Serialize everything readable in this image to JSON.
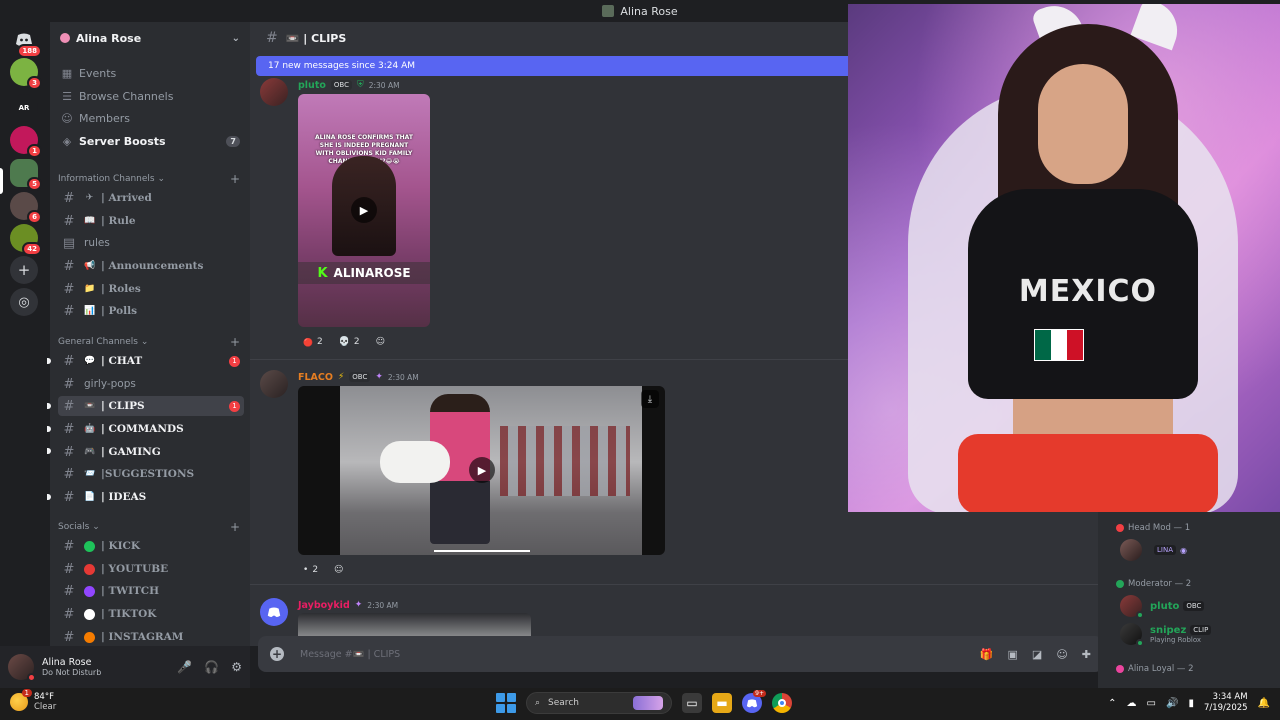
{
  "window": {
    "title": "Alina Rose"
  },
  "rail": {
    "servers": [
      {
        "name": "discord-home",
        "badge": "188",
        "color": "#5865f2"
      },
      {
        "name": "server-2",
        "badge": "3",
        "color": "#7cb342"
      },
      {
        "name": "server-ar",
        "label": "AR",
        "badge": "",
        "color": "#1e1f22"
      },
      {
        "name": "server-4",
        "badge": "1",
        "color": "#c2185b"
      },
      {
        "name": "server-5",
        "badge": "5",
        "color": "#4e7a4e"
      },
      {
        "name": "server-6",
        "badge": "6",
        "color": "#5a4a48"
      },
      {
        "name": "server-7",
        "badge": "42",
        "color": "#6b8e23"
      }
    ],
    "add_label": "+",
    "explore_label": "◎"
  },
  "server": {
    "name": "Alina Rose"
  },
  "nav": {
    "events": "Events",
    "browse": "Browse Channels",
    "members": "Members",
    "boosts": "Server Boosts",
    "boosts_count": "7"
  },
  "categories": {
    "info": "Information Channels",
    "general": "General Channels",
    "socials": "Socials"
  },
  "channels": {
    "arrived": {
      "emoji": "✈",
      "name": "| Arrived"
    },
    "rule": {
      "emoji": "📖",
      "name": "| Rule"
    },
    "rules": {
      "name": "rules"
    },
    "announcements": {
      "emoji": "📢",
      "name": "| Announcements"
    },
    "roles": {
      "emoji": "📁",
      "name": "| Roles"
    },
    "polls": {
      "emoji": "📊",
      "name": "| Polls"
    },
    "chat": {
      "emoji": "💬",
      "name": "| CHAT",
      "badge": "1"
    },
    "girlypops": {
      "name": "girly-pops"
    },
    "clips": {
      "emoji": "📼",
      "name": "| CLIPS",
      "badge": "1"
    },
    "commands": {
      "emoji": "🤖",
      "name": "| COMMANDS"
    },
    "gaming": {
      "emoji": "🎮",
      "name": "| GAMING"
    },
    "suggestions": {
      "emoji": "📨",
      "name": "|SUGGESTIONS"
    },
    "ideas": {
      "emoji": "📄",
      "name": "| IDEAS"
    },
    "kick": {
      "name": "| KICK",
      "color": "#1ec25a"
    },
    "youtube": {
      "name": "| YOUTUBE",
      "color": "#e53935"
    },
    "twitch": {
      "name": "| TWITCH",
      "color": "#9146ff"
    },
    "tiktok": {
      "name": "| TIKTOK",
      "color": "#ffffff"
    },
    "instagram": {
      "name": "| INSTAGRAM",
      "color": "#f57c00"
    }
  },
  "user": {
    "name": "Alina Rose",
    "status": "Do Not Disturb"
  },
  "header": {
    "channel": "📼 | CLIPS"
  },
  "chat": {
    "new_messages": "17 new messages since 3:24 AM",
    "messages": [
      {
        "author": "pluto",
        "author_color": "#23a559",
        "tag": "OBC",
        "time": "2:30 AM",
        "clip_caption": "ALINA ROSE CONFIRMS THAT SHE IS INDEED PREGNANT WITH OBLIVIONS KID FAMILY CHANNEL SOON?😂😭",
        "clip_brand": "ALINAROSE",
        "reactions": [
          {
            "emoji": "🔴",
            "count": "2"
          },
          {
            "emoji": "💀",
            "count": "2"
          }
        ]
      },
      {
        "author": "FLACO",
        "author_color": "#e67e22",
        "tag": "OBC",
        "time": "2:30 AM",
        "reactions": [
          {
            "emoji": "•",
            "count": "2"
          }
        ]
      },
      {
        "author": "Jayboykid",
        "author_color": "#e91e63",
        "time": "2:30 AM"
      }
    ]
  },
  "composer": {
    "placeholder": "Message #📼 | CLIPS"
  },
  "stream": {
    "shirt_text": "MEXICO"
  },
  "members": {
    "roles": [
      {
        "name": "Head Mod — 1",
        "color": "#f23f43"
      },
      {
        "name": "Moderator — 2",
        "color": "#23a559"
      },
      {
        "name": "Alina Loyal — 2",
        "color": "#eb459e"
      }
    ],
    "list": [
      {
        "name": "LINA",
        "color": "#b9a4ff",
        "tag": "",
        "sub": ""
      },
      {
        "name": "pluto",
        "color": "#23a559",
        "tag": "OBC",
        "sub": ""
      },
      {
        "name": "snipez",
        "color": "#23a559",
        "tag": "CLIP",
        "sub": "Playing Roblox"
      }
    ]
  },
  "taskbar": {
    "weather_temp": "84°F",
    "weather_desc": "Clear",
    "weather_badge": "1",
    "search_label": "Search",
    "discord_badge": "9+",
    "time": "3:34 AM",
    "date": "7/19/2025"
  }
}
